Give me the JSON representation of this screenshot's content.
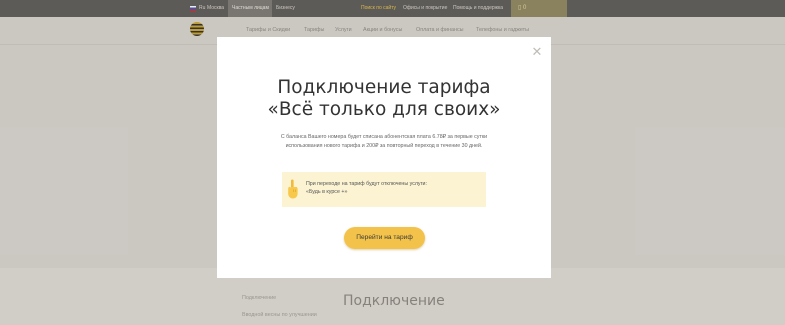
{
  "topbar": {
    "region_flag": "ru-flag-icon",
    "region_code": "Ru",
    "city": "Москва",
    "segment_private": "Частным лицам",
    "segment_business": "Бизнесу",
    "search": "Поиск по сайту",
    "offices": "Офисы и покрытие",
    "help": "Помощь и поддержка",
    "cart_icon": "cart-icon",
    "cart_count": "0"
  },
  "nav": {
    "items": [
      "Тарифы и Скидки",
      "Тарифы",
      "Услуги",
      "Акции и бонусы",
      "Оплата и финансы",
      "Телефоны и гаджеты"
    ]
  },
  "background": {
    "sidebar_1": "Подключение",
    "sidebar_2": "Вводной весны по улучшении",
    "heading": "Подключение"
  },
  "modal": {
    "close_icon": "close-icon",
    "title_line1": "Подключение тарифа",
    "title_line2": "«Всё только для своих»",
    "text_line1": "С баланса Вашего номера будет списана абонентская плата 6.78₽ за первые сутки",
    "text_line2": "использования нового тарифа и 200₽ за повторный переход в течение 30 дней.",
    "notice_icon": "pointing-hand-icon",
    "notice_line1": "При переходе на тариф будут отключены услуги:",
    "notice_line2": "«Будь в курсе +»",
    "button_label": "Перейти на тариф"
  },
  "colors": {
    "accent": "#f3c24a",
    "notice_bg": "#fbf3d2",
    "topbar_bg": "#5c5a57"
  }
}
